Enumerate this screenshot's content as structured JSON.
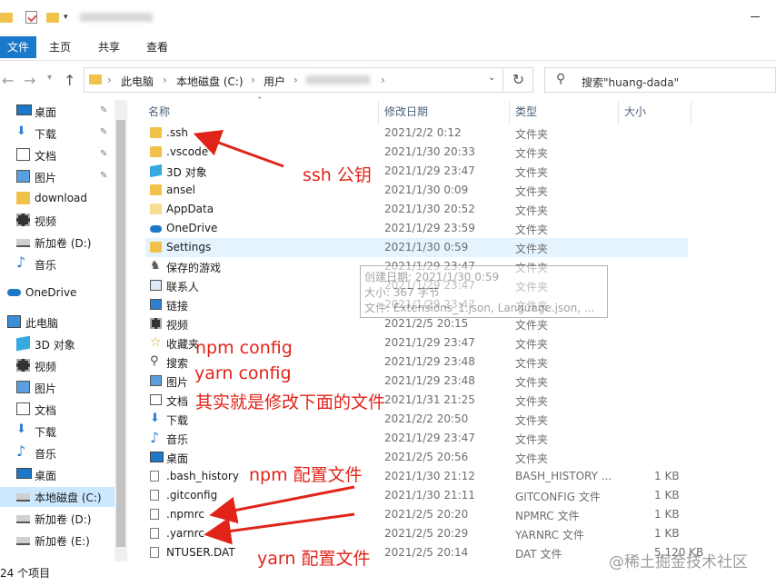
{
  "ribbon": {
    "file": "文件",
    "home": "主页",
    "share": "共享",
    "view": "查看"
  },
  "address": {
    "seg1": "此电脑",
    "seg2": "本地磁盘 (C:)",
    "seg3": "用户"
  },
  "search": {
    "placeholder": "搜索\"huang-dada\""
  },
  "columns": {
    "name": "名称",
    "date": "修改日期",
    "type": "类型",
    "size": "大小"
  },
  "sidebar": [
    {
      "label": "桌面",
      "icon": "desktop-icon",
      "pinned": true
    },
    {
      "label": "下载",
      "icon": "download-arrow-icon",
      "pinned": true
    },
    {
      "label": "文档",
      "icon": "document-icon",
      "pinned": true
    },
    {
      "label": "图片",
      "icon": "picture-icon",
      "pinned": true
    },
    {
      "label": "download",
      "icon": "folder-icon",
      "pinned": false
    },
    {
      "label": "视频",
      "icon": "video-icon",
      "pinned": false
    },
    {
      "label": "新加卷 (D:)",
      "icon": "drive-icon",
      "pinned": false
    },
    {
      "label": "音乐",
      "icon": "music-icon",
      "pinned": false
    },
    {
      "label": "OneDrive",
      "icon": "cloud-icon",
      "pinned": false
    },
    {
      "label": "此电脑",
      "icon": "computer-icon",
      "pinned": false
    },
    {
      "label": "3D 对象",
      "icon": "3d-object-icon",
      "pinned": false
    },
    {
      "label": "视频",
      "icon": "video-icon",
      "pinned": false
    },
    {
      "label": "图片",
      "icon": "picture-icon",
      "pinned": false
    },
    {
      "label": "文档",
      "icon": "document-icon",
      "pinned": false
    },
    {
      "label": "下载",
      "icon": "download-arrow-icon",
      "pinned": false
    },
    {
      "label": "音乐",
      "icon": "music-icon",
      "pinned": false
    },
    {
      "label": "桌面",
      "icon": "desktop-icon",
      "pinned": false
    },
    {
      "label": "本地磁盘 (C:)",
      "icon": "drive-icon",
      "pinned": false,
      "selected": true
    },
    {
      "label": "新加卷 (D:)",
      "icon": "drive-icon",
      "pinned": false
    },
    {
      "label": "新加卷 (E:)",
      "icon": "drive-icon",
      "pinned": false
    }
  ],
  "files": [
    {
      "name": ".ssh",
      "date": "2021/2/2 0:12",
      "type": "文件夹",
      "size": "",
      "icon": "folder-icon"
    },
    {
      "name": ".vscode",
      "date": "2021/1/30 20:33",
      "type": "文件夹",
      "size": "",
      "icon": "folder-icon"
    },
    {
      "name": "3D 对象",
      "date": "2021/1/29 23:47",
      "type": "文件夹",
      "size": "",
      "icon": "3d-object-icon"
    },
    {
      "name": "ansel",
      "date": "2021/1/30 0:09",
      "type": "文件夹",
      "size": "",
      "icon": "folder-icon"
    },
    {
      "name": "AppData",
      "date": "2021/1/30 20:52",
      "type": "文件夹",
      "size": "",
      "icon": "folder-faded-icon"
    },
    {
      "name": "OneDrive",
      "date": "2021/1/29 23:59",
      "type": "文件夹",
      "size": "",
      "icon": "cloud-icon"
    },
    {
      "name": "Settings",
      "date": "2021/1/30 0:59",
      "type": "文件夹",
      "size": "",
      "icon": "folder-icon",
      "selected": true
    },
    {
      "name": "保存的游戏",
      "date": "2021/1/29 23:47",
      "type": "文件夹",
      "size": "",
      "icon": "saved-games-icon"
    },
    {
      "name": "联系人",
      "date": "2021/1/29 23:47",
      "type": "文件夹",
      "size": "",
      "icon": "contacts-icon"
    },
    {
      "name": "链接",
      "date": "2021/1/29 23:47",
      "type": "文件夹",
      "size": "",
      "icon": "links-icon"
    },
    {
      "name": "视频",
      "date": "2021/2/5 20:15",
      "type": "文件夹",
      "size": "",
      "icon": "video-icon"
    },
    {
      "name": "收藏夹",
      "date": "2021/1/29 23:47",
      "type": "文件夹",
      "size": "",
      "icon": "favorites-star-icon"
    },
    {
      "name": "搜索",
      "date": "2021/1/29 23:48",
      "type": "文件夹",
      "size": "",
      "icon": "search-icon"
    },
    {
      "name": "图片",
      "date": "2021/1/29 23:48",
      "type": "文件夹",
      "size": "",
      "icon": "picture-icon"
    },
    {
      "name": "文档",
      "date": "2021/1/31 21:25",
      "type": "文件夹",
      "size": "",
      "icon": "document-icon"
    },
    {
      "name": "下载",
      "date": "2021/2/2 20:50",
      "type": "文件夹",
      "size": "",
      "icon": "download-arrow-icon"
    },
    {
      "name": "音乐",
      "date": "2021/1/29 23:47",
      "type": "文件夹",
      "size": "",
      "icon": "music-icon"
    },
    {
      "name": "桌面",
      "date": "2021/2/5 20:56",
      "type": "文件夹",
      "size": "",
      "icon": "desktop-icon"
    },
    {
      "name": ".bash_history",
      "date": "2021/1/30 21:12",
      "type": "BASH_HISTORY ...",
      "size": "1 KB",
      "icon": "file-icon"
    },
    {
      "name": ".gitconfig",
      "date": "2021/1/30 21:11",
      "type": "GITCONFIG 文件",
      "size": "1 KB",
      "icon": "file-icon"
    },
    {
      "name": ".npmrc",
      "date": "2021/2/5 20:20",
      "type": "NPMRC 文件",
      "size": "1 KB",
      "icon": "file-icon"
    },
    {
      "name": ".yarnrc",
      "date": "2021/2/5 20:29",
      "type": "YARNRC 文件",
      "size": "1 KB",
      "icon": "file-icon"
    },
    {
      "name": "NTUSER.DAT",
      "date": "2021/2/5 20:14",
      "type": "DAT 文件",
      "size": "5,120 KB",
      "icon": "file-icon"
    }
  ],
  "tooltip": {
    "line1": "创建日期: 2021/1/30 0:59",
    "line2": "大小: 367 字节",
    "line3": "文件: Extensions_1.json, Language.json, ..."
  },
  "status": {
    "item_count": "24 个项目"
  },
  "annotations": {
    "ssh": "ssh 公钥",
    "npm_config": "npm config",
    "yarn_config": "yarn config",
    "modify_note": "其实就是修改下面的文件",
    "npm_file": "npm 配置文件",
    "yarn_file": "yarn 配置文件"
  },
  "watermark": "@稀土掘金技术社区",
  "colors": {
    "accent": "#1979ca",
    "folder": "#f0c24b",
    "annotation": "#e0241a",
    "selection": "#cce8ff"
  }
}
